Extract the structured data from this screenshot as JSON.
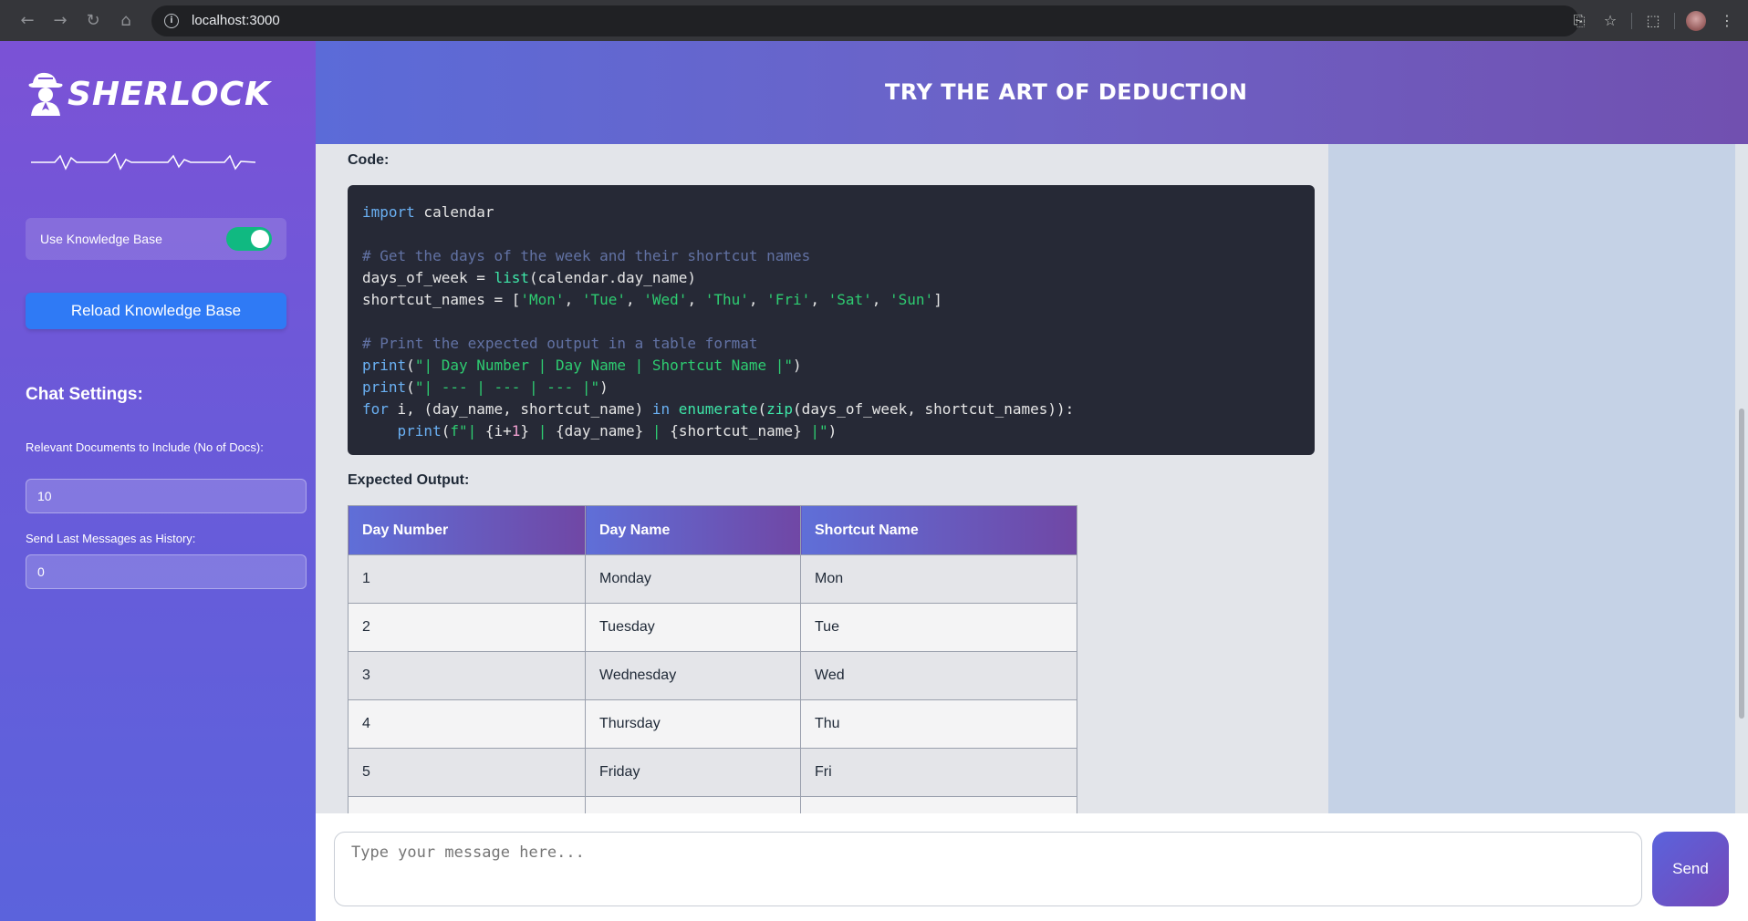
{
  "browser": {
    "url": "localhost:3000",
    "back_icon": "←",
    "forward_icon": "→",
    "reload_icon": "↻",
    "home_icon": "⌂",
    "info_icon": "i",
    "install_icon": "⎘",
    "star_icon": "☆",
    "extensions_icon": "⬚",
    "menu_icon": "⋮"
  },
  "sidebar": {
    "logo_text": "SHERLOCK",
    "use_kb_label": "Use Knowledge Base",
    "use_kb_enabled": true,
    "reload_label": "Reload Knowledge Base",
    "chat_settings_title": "Chat Settings:",
    "docs_label": "Relevant Documents to Include (No of Docs):",
    "docs_value": "10",
    "history_label": "Send Last Messages as History:",
    "history_value": "0"
  },
  "header": {
    "title": "TRY THE ART OF DEDUCTION"
  },
  "chat": {
    "code_label": "Code:",
    "output_label": "Expected Output:",
    "table_headers": [
      "Day Number",
      "Day Name",
      "Shortcut Name"
    ],
    "table_rows": [
      [
        "1",
        "Monday",
        "Mon"
      ],
      [
        "2",
        "Tuesday",
        "Tue"
      ],
      [
        "3",
        "Wednesday",
        "Wed"
      ],
      [
        "4",
        "Thursday",
        "Thu"
      ],
      [
        "5",
        "Friday",
        "Fri"
      ]
    ]
  },
  "input": {
    "placeholder": "Type your message here...",
    "send_label": "Send"
  },
  "colors": {
    "sidebar_top": "#7b52d6",
    "sidebar_bottom": "#5b63dc",
    "toggle_on": "#10b981",
    "reload_button": "#2f7af5",
    "code_bg": "#262936"
  }
}
